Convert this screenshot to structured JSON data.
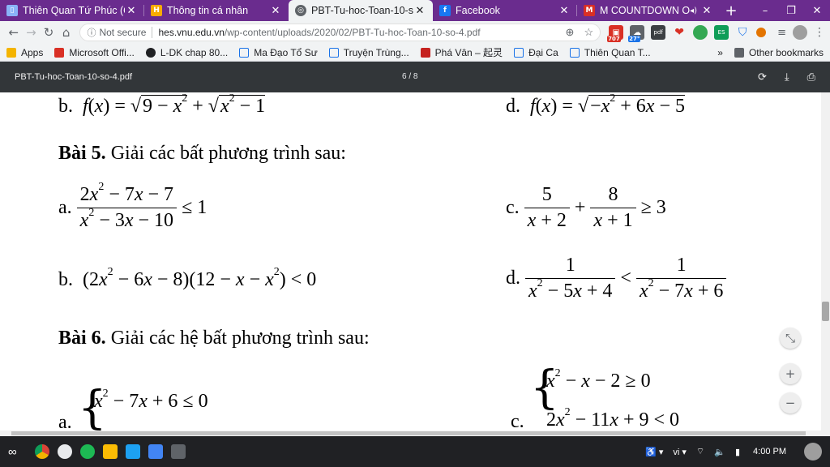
{
  "tabs": [
    {
      "title": "Thiên Quan Tứ Phúc (Qu",
      "favicon_color": "#8ab4f8",
      "active": false
    },
    {
      "title": "Thông tin cá nhân",
      "favicon_color": "#f9ab00",
      "active": false
    },
    {
      "title": "PBT-Tu-hoc-Toan-10-so",
      "favicon_color": "#5f6368",
      "active": true
    },
    {
      "title": "Facebook",
      "favicon_color": "#1877f2",
      "active": false
    },
    {
      "title": "M COUNTDOWN O",
      "favicon_color": "#d93025",
      "active": false
    }
  ],
  "address": {
    "security": "Not secure",
    "domain": "hes.vnu.edu.vn",
    "path": "/wp-content/uploads/2020/02/PBT-Tu-hoc-Toan-10-so-4.pdf"
  },
  "extensions": {
    "badge1": "707",
    "badge2": "27°",
    "badge3": "pdf",
    "badge4": "ES"
  },
  "bookmarks": [
    {
      "label": "Apps",
      "color": "#f4b400"
    },
    {
      "label": "Microsoft Offi...",
      "color": "#d93025"
    },
    {
      "label": "L-DK chap 80...",
      "color": "#202124"
    },
    {
      "label": "Ma Đạo Tổ Sư",
      "color": "#8ab4f8"
    },
    {
      "label": "Truyện Trùng...",
      "color": "#8ab4f8"
    },
    {
      "label": "Phá Vân – 起灵",
      "color": "#c5221f"
    },
    {
      "label": "Đại Ca",
      "color": "#8ab4f8"
    },
    {
      "label": "Thiên Quan T...",
      "color": "#8ab4f8"
    }
  ],
  "bookmarks_more": "»",
  "other_bookmarks": "Other bookmarks",
  "pdf": {
    "filename": "PBT-Tu-hoc-Toan-10-so-4.pdf",
    "page_indicator": "6 / 8"
  },
  "document": {
    "top_b_label": "b.",
    "top_d_label": "d.",
    "bai5_number": "Bài 5.",
    "bai5_text": " Giải các bất phương trình sau:",
    "bai6_number": "Bài 6.",
    "bai6_text": " Giải các hệ bất phương trình sau:",
    "a": "a.",
    "b": "b.",
    "c": "c.",
    "d": "d."
  },
  "taskbar": {
    "lang": "vi",
    "time": "4:00 PM"
  }
}
